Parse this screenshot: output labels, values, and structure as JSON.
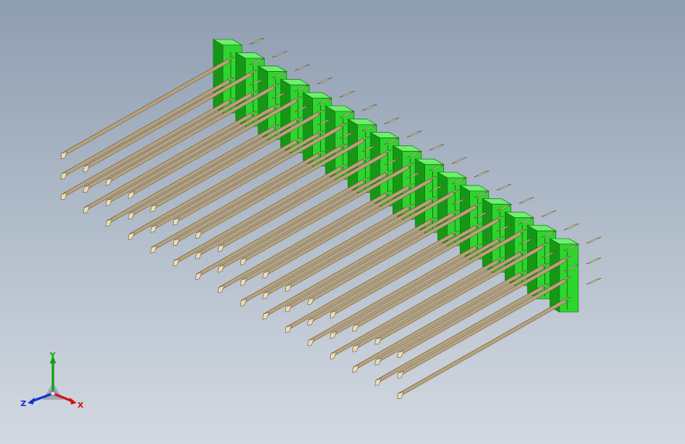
{
  "viewport": {
    "background_top": "#8e9db0",
    "background_bottom": "#d3d9e2"
  },
  "model": {
    "name": "pin-header",
    "pin_count": 16,
    "rows": 3,
    "housing_color": "#2fd52f",
    "housing_dark": "#169816",
    "housing_light": "#6ef06e",
    "pin_color": "#eedcb0",
    "pin_shade": "#b8a27a",
    "pin_edge": "#5a4a30"
  },
  "triad": {
    "x_label": "X",
    "y_label": "Y",
    "z_label": "Z",
    "x_color": "#d01010",
    "y_color": "#10a010",
    "z_color": "#1030d0"
  }
}
